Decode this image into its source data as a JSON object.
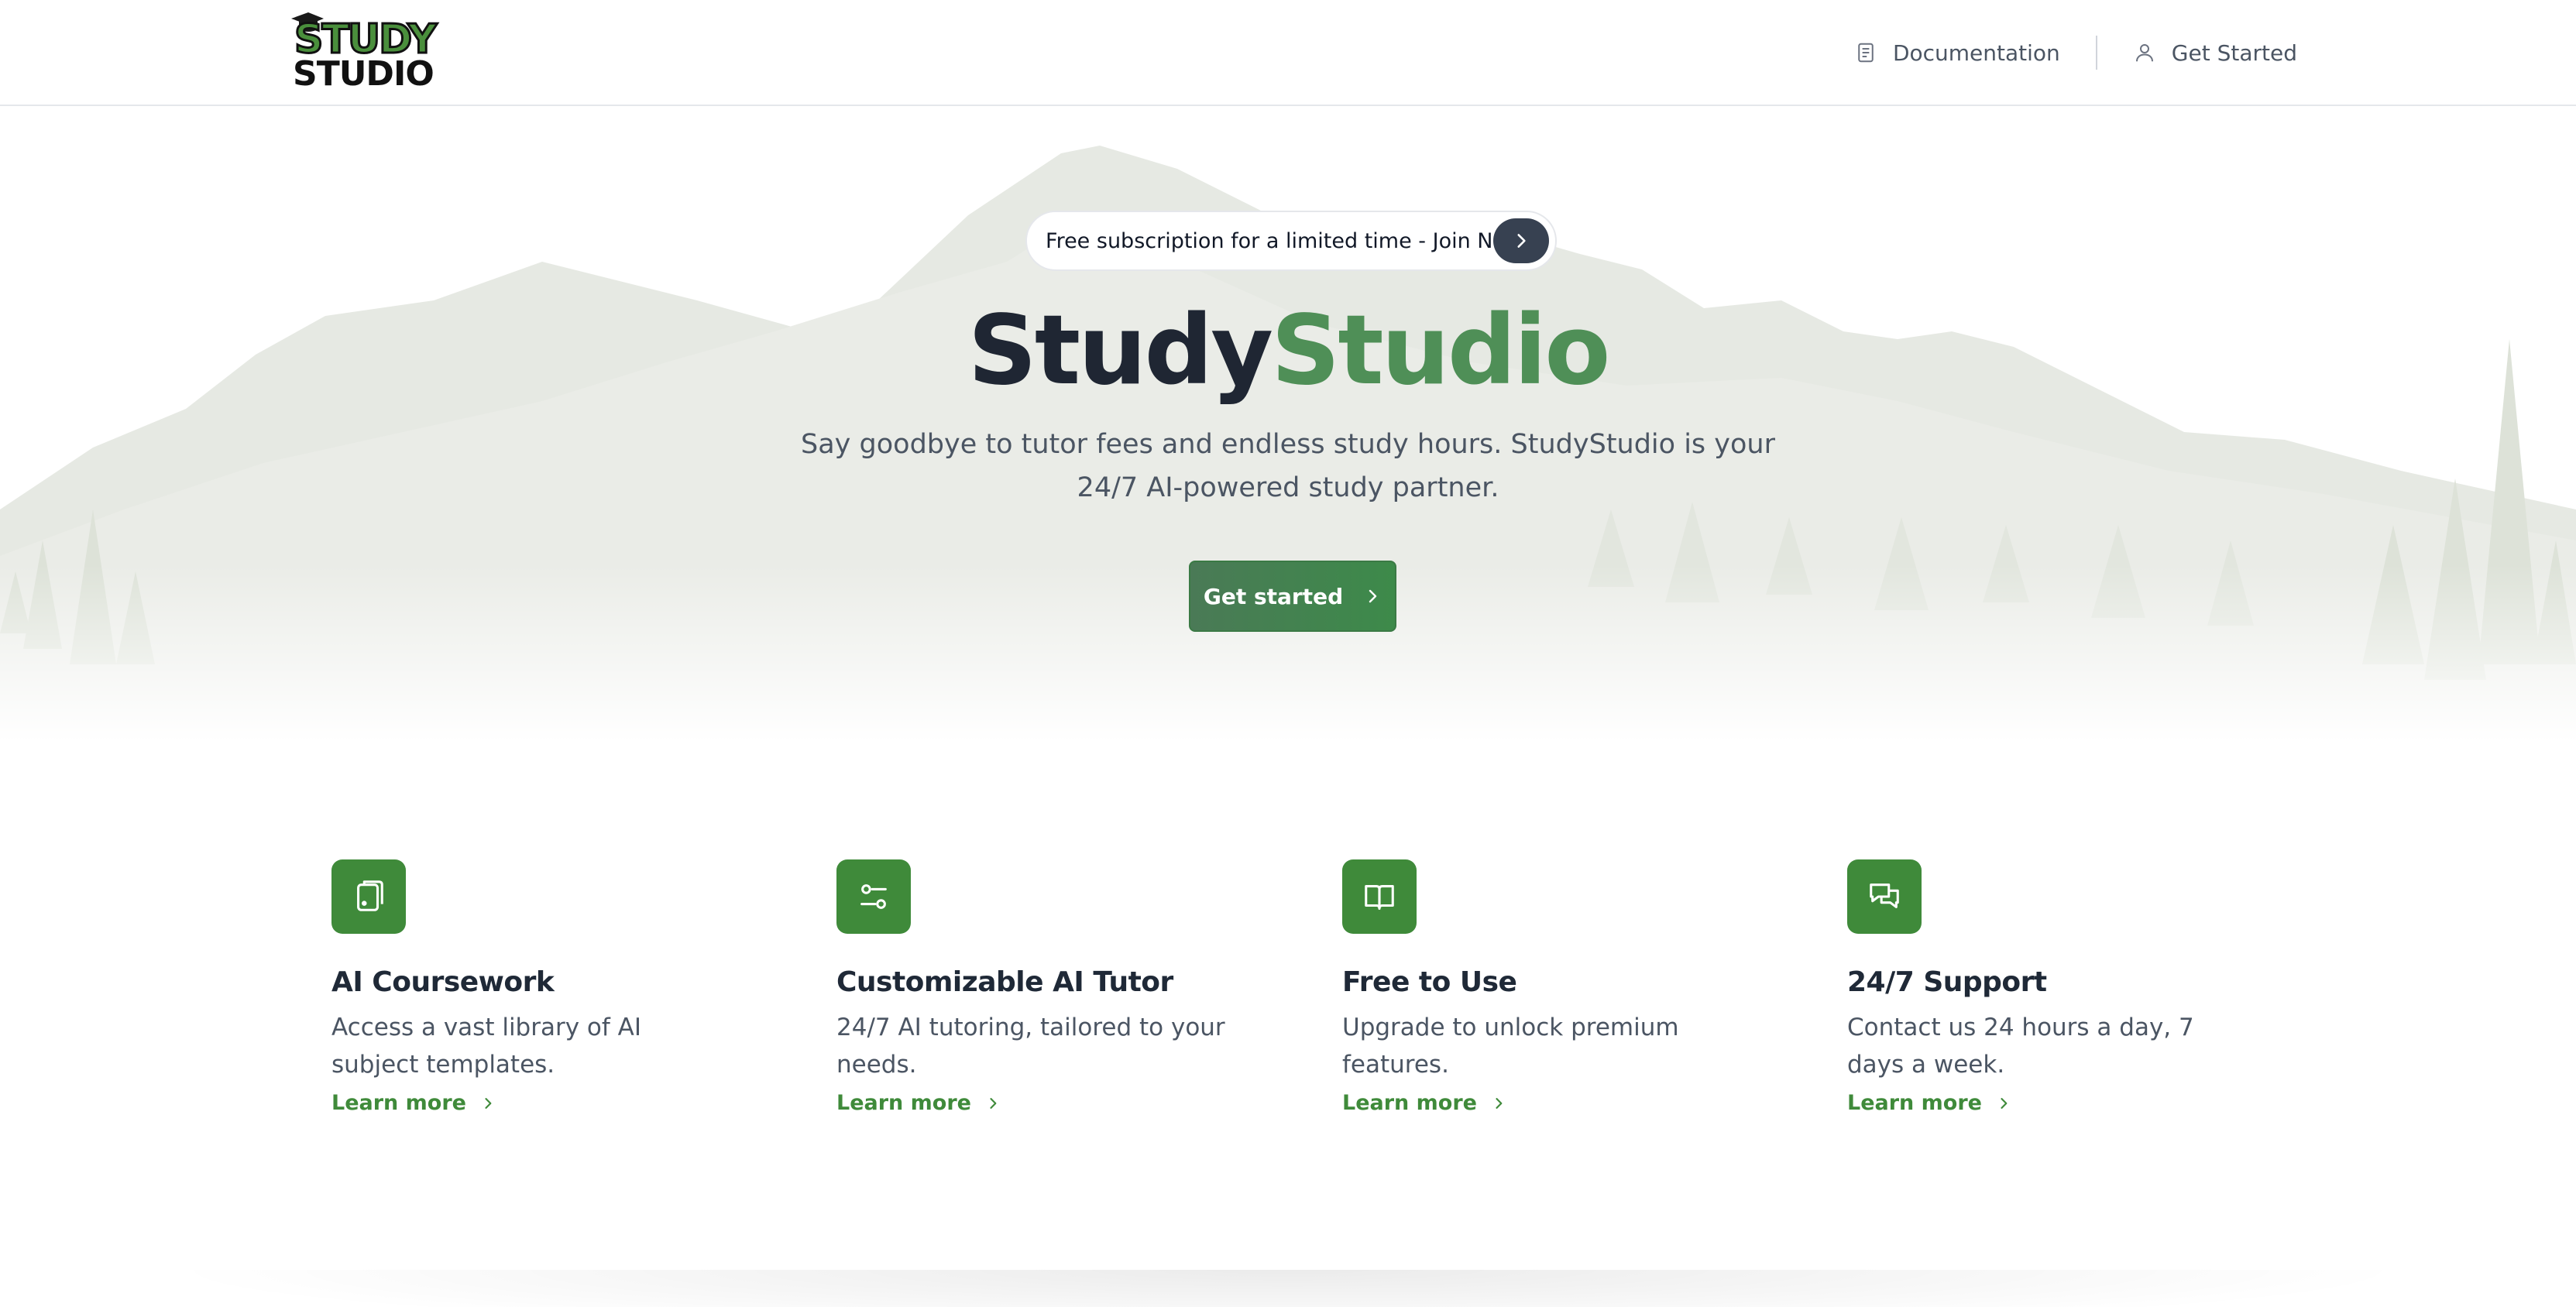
{
  "header": {
    "logo_alt": "STUDY STUDIO",
    "logo_line1": "STUDY",
    "logo_line2": "STUDIO",
    "nav": {
      "documentation": "Documentation",
      "get_started": "Get Started"
    }
  },
  "hero": {
    "promo_text": "Free subscription for a limited time - Join Now",
    "title_part1": "Study",
    "title_part2": "Studio",
    "subtitle": "Say goodbye to tutor fees and endless study hours. StudyStudio is your 24/7 AI-powered study partner.",
    "cta_label": "Get started"
  },
  "features": [
    {
      "icon": "tablet-icon",
      "title": "AI Coursework",
      "description": "Access a vast library of AI subject templates.",
      "link": "Learn more"
    },
    {
      "icon": "sliders-icon",
      "title": "Customizable AI Tutor",
      "description": "24/7 AI tutoring, tailored to your needs.",
      "link": "Learn more"
    },
    {
      "icon": "book-open-icon",
      "title": "Free to Use",
      "description": "Upgrade to unlock premium features.",
      "link": "Learn more"
    },
    {
      "icon": "chat-bubbles-icon",
      "title": "24/7 Support",
      "description": "Contact us 24 hours a day, 7 days a week.",
      "link": "Learn more"
    }
  ],
  "colors": {
    "brand_green": "#3f8a3a",
    "title_dark": "#1f2633",
    "title_green": "#4f8f57",
    "promo_button": "#374151"
  }
}
